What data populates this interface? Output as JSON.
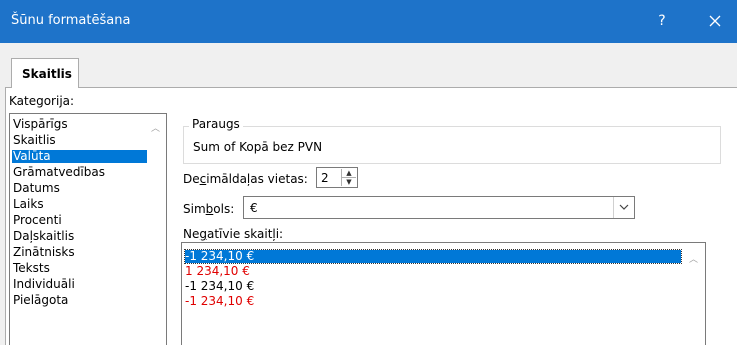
{
  "window": {
    "title": "Šūnu formatēšana",
    "help": "?",
    "close_icon": "close-icon"
  },
  "tabs": [
    {
      "label": "Skaitlis",
      "active": true
    }
  ],
  "category": {
    "label": "Kategorija:",
    "items": [
      "Vispārīgs",
      "Skaitlis",
      "Valūta",
      "Grāmatvedības",
      "Datums",
      "Laiks",
      "Procenti",
      "Daļskaitlis",
      "Zinātnisks",
      "Teksts",
      "Individuāli",
      "Pielāgota"
    ],
    "selected": "Valūta"
  },
  "sample": {
    "legend": "Paraugs",
    "value": "Sum of Kopā bez PVN"
  },
  "decimal": {
    "label_pre": "De",
    "label_u": "c",
    "label_post": "imāldaļas vietas:",
    "value": "2"
  },
  "symbol": {
    "label_pre": "Sim",
    "label_u": "b",
    "label_post": "ols:",
    "value": "€"
  },
  "negative": {
    "label_pre": "Ne",
    "label_u": "g",
    "label_post": "atīvie skaitļi:",
    "items": [
      {
        "text": "-1 234,10 €",
        "color": "#000000",
        "selected": true
      },
      {
        "text": "1 234,10 €",
        "color": "#e00000",
        "selected": false
      },
      {
        "text": "-1 234,10 €",
        "color": "#000000",
        "selected": false
      },
      {
        "text": "-1 234,10 €",
        "color": "#e00000",
        "selected": false
      }
    ]
  },
  "colors": {
    "titlebar": "#1e73c9",
    "selection": "#0078d7",
    "negative_red": "#e00000"
  }
}
